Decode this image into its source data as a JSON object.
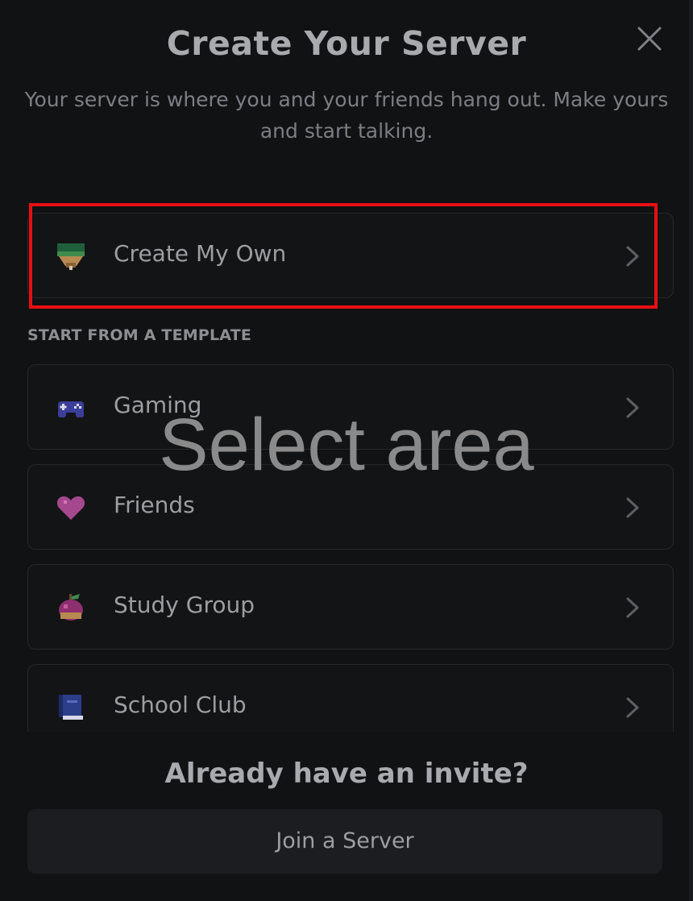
{
  "modal": {
    "title": "Create Your Server",
    "subtitle": "Your server is where you and your friends hang out. Make yours and start talking.",
    "close_icon": "close-icon"
  },
  "create_own": {
    "label": "Create My Own",
    "icon": "create-server-icon"
  },
  "templates": {
    "section_label": "START FROM A TEMPLATE",
    "items": [
      {
        "label": "Gaming",
        "icon": "gamepad-icon"
      },
      {
        "label": "Friends",
        "icon": "heart-icon"
      },
      {
        "label": "Study Group",
        "icon": "apple-icon"
      },
      {
        "label": "School Club",
        "icon": "book-icon"
      }
    ]
  },
  "footer": {
    "invite_heading": "Already have an invite?",
    "join_label": "Join a Server"
  },
  "overlay": {
    "text": "Select area"
  },
  "colors": {
    "background": "#111214",
    "highlight": "#e80f13",
    "text_primary": "#a8aaae",
    "text_secondary": "#7c7e83"
  }
}
